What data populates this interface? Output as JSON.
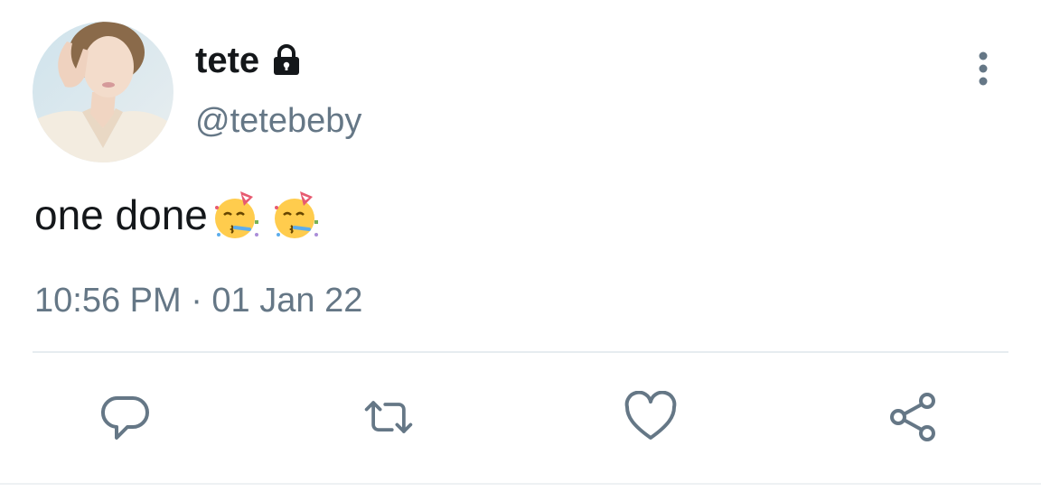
{
  "tweet": {
    "display_name": "tete",
    "handle": "@tetebeby",
    "text": "one done",
    "emojis": [
      "partying-face",
      "partying-face"
    ],
    "timestamp": "10:56 PM · 01 Jan 22",
    "protected": true
  },
  "actions": {
    "reply_icon": "reply-icon",
    "retweet_icon": "retweet-icon",
    "like_icon": "heart-icon",
    "share_icon": "share-icon",
    "more_icon": "more-vertical-icon"
  },
  "colors": {
    "text": "#14171a",
    "secondary": "#657786",
    "divider": "#e6ecf0"
  }
}
